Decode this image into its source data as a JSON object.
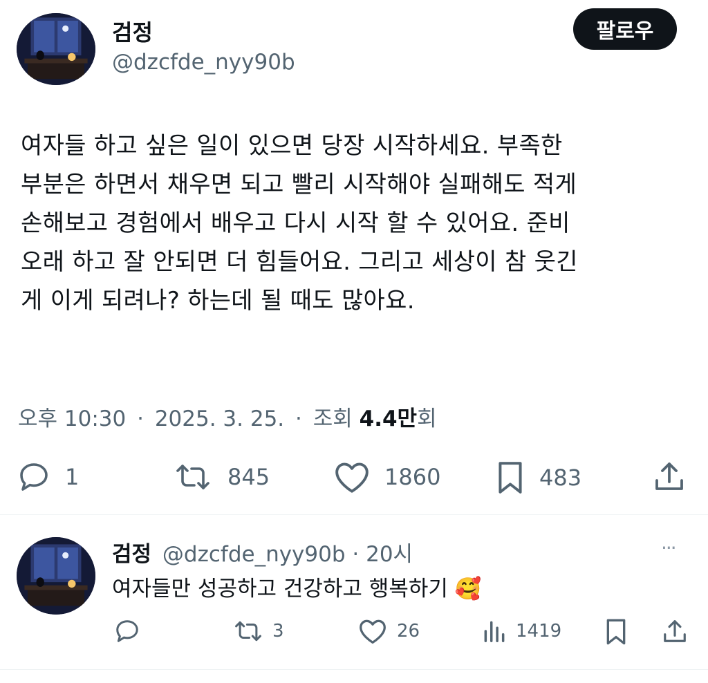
{
  "tweet": {
    "author_name": "검정",
    "author_handle": "@dzcfde_nyy90b",
    "follow_label": "팔로우",
    "text": "여자들 하고 싶은 일이 있으면 당장 시작하세요. 부족한\n부분은 하면서 채우면 되고 빨리 시작해야 실패해도 적게\n손해보고 경험에서 배우고 다시 시작 할 수 있어요. 준비\n오래 하고 잘 안되면 더 힘들어요. 그리고 세상이 참 웃긴\n게 이게 되려나? 하는데 될 때도 많아요.",
    "time": "오후 10:30",
    "date": "2025. 3. 25.",
    "views_label": "조회",
    "views_count": "4.4만",
    "views_suffix": "회",
    "separator": "·",
    "actions": {
      "reply_count": "1",
      "retweet_count": "845",
      "like_count": "1860",
      "bookmark_count": "483"
    }
  },
  "reply": {
    "author_name": "검정",
    "author_handle": "@dzcfde_nyy90b",
    "separator": "·",
    "time": "20시",
    "text": "여자들만 성공하고 건강하고 행복하기 🥰",
    "more_label": "···",
    "actions": {
      "retweet_count": "3",
      "like_count": "26",
      "views_count": "1419"
    }
  },
  "colors": {
    "text": "#0f1419",
    "secondary": "#536471",
    "follow_bg": "#0f1419",
    "divider": "#eff3f4"
  },
  "icons": [
    "reply-icon",
    "retweet-icon",
    "heart-icon",
    "bookmark-icon",
    "share-icon",
    "views-icon",
    "more-icon"
  ]
}
